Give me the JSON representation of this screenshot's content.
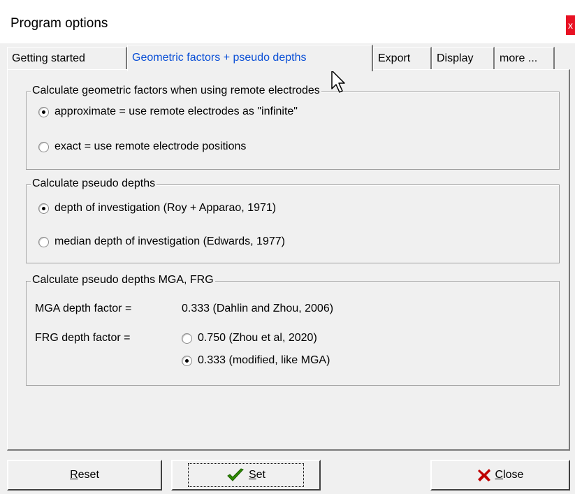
{
  "window": {
    "title": "Program options",
    "close_glyph": "x"
  },
  "tabs": [
    {
      "label": "Getting started",
      "active": false
    },
    {
      "label": "Geometric factors + pseudo depths",
      "active": true
    },
    {
      "label": "Export",
      "active": false
    },
    {
      "label": "Display",
      "active": false
    },
    {
      "label": "more ...",
      "active": false
    }
  ],
  "group_remote": {
    "legend": "Calculate geometric factors when using remote electrodes",
    "options": [
      {
        "label": "approximate = use remote electrodes as \"infinite\"",
        "checked": true
      },
      {
        "label": "exact = use remote electrode positions",
        "checked": false
      }
    ]
  },
  "group_pseudo": {
    "legend": "Calculate pseudo depths",
    "options": [
      {
        "label": "depth of investigation (Roy + Apparao, 1971)",
        "checked": true
      },
      {
        "label": "median depth of investigation (Edwards, 1977)",
        "checked": false
      }
    ]
  },
  "group_mga": {
    "legend": "Calculate pseudo depths MGA, FRG",
    "mga_label": "MGA depth factor =",
    "mga_value": "0.333 (Dahlin and Zhou, 2006)",
    "frg_label": "FRG depth factor =",
    "frg_options": [
      {
        "label": "0.750 (Zhou et al, 2020)",
        "checked": false
      },
      {
        "label": "0.333 (modified, like MGA)",
        "checked": true
      }
    ]
  },
  "buttons": {
    "reset": {
      "label_hotkey": "R",
      "label_rest": "eset"
    },
    "set": {
      "label_hotkey": "S",
      "label_rest": "et",
      "icon": "checkmark-icon",
      "icon_color": "#2e8b00"
    },
    "close": {
      "label_hotkey": "C",
      "label_rest": "lose",
      "icon": "x-icon",
      "icon_color": "#c00000"
    }
  }
}
